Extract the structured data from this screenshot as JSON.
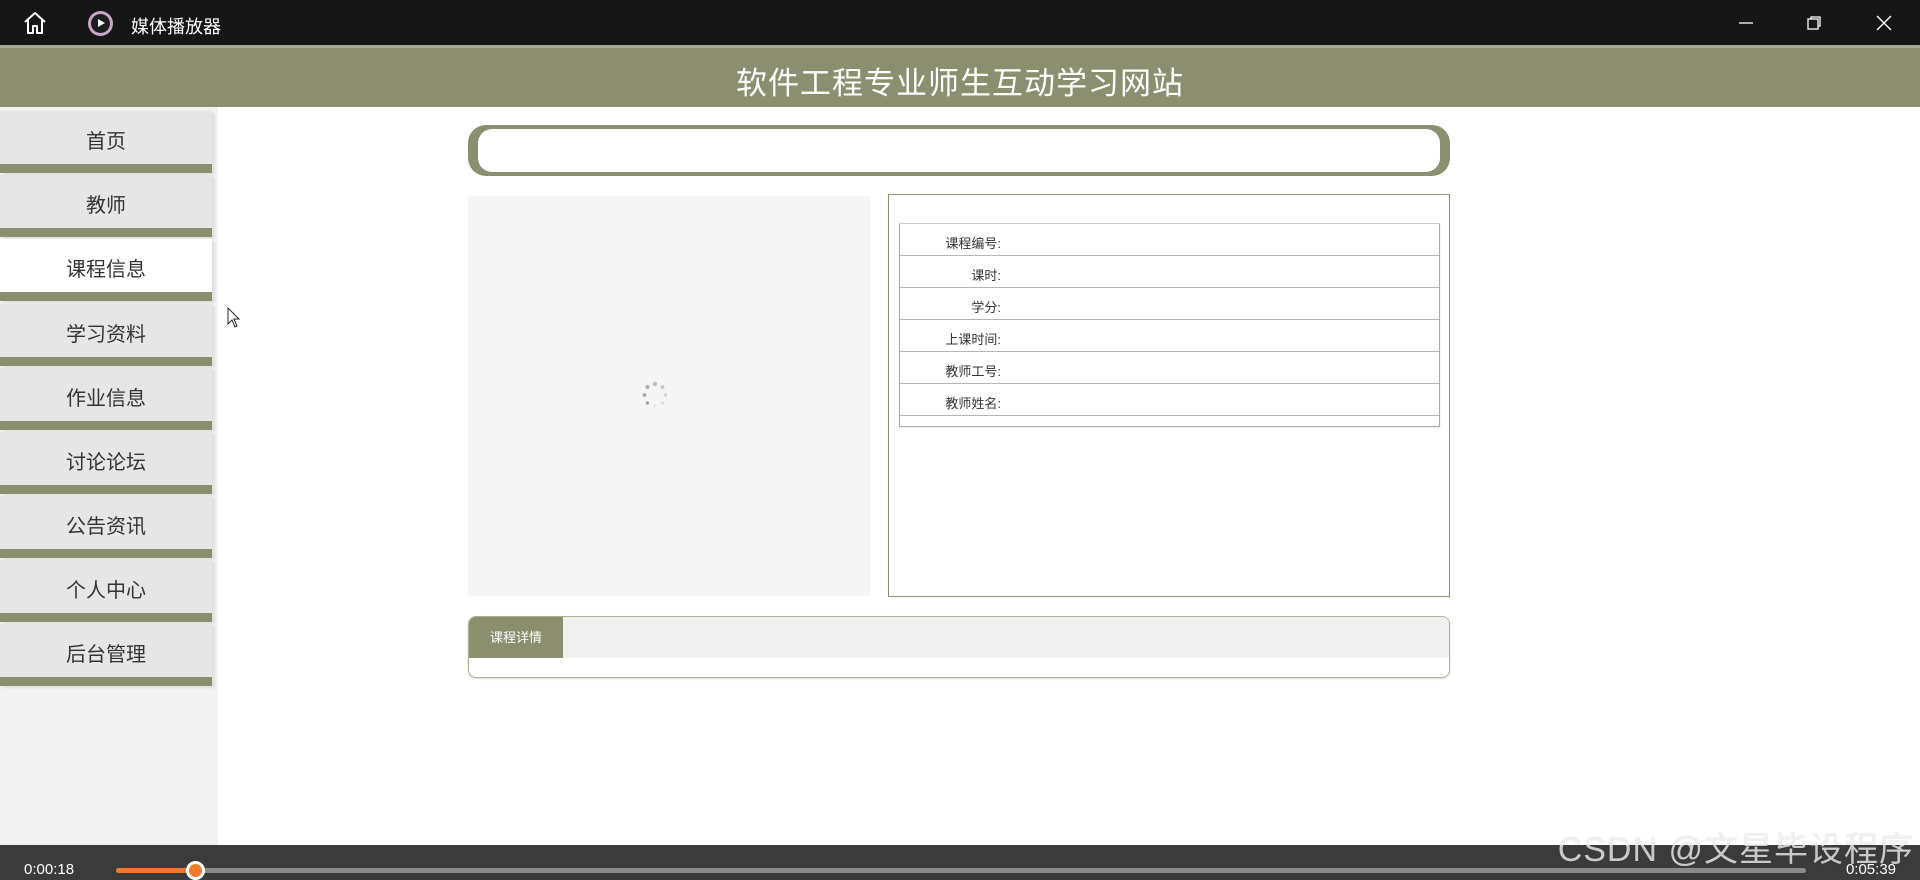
{
  "titlebar": {
    "app_title": "媒体播放器",
    "icons": [
      "home-icon",
      "media-player-icon",
      "minimize-icon",
      "restore-icon",
      "close-icon"
    ]
  },
  "site": {
    "title": "软件工程专业师生互动学习网站"
  },
  "sidebar": {
    "items": [
      {
        "label": "首页",
        "active": false
      },
      {
        "label": "教师",
        "active": false
      },
      {
        "label": "课程信息",
        "active": true
      },
      {
        "label": "学习资料",
        "active": false
      },
      {
        "label": "作业信息",
        "active": false
      },
      {
        "label": "讨论论坛",
        "active": false
      },
      {
        "label": "公告资讯",
        "active": false
      },
      {
        "label": "个人中心",
        "active": false
      },
      {
        "label": "后台管理",
        "active": false
      }
    ]
  },
  "course_info": {
    "rows": [
      {
        "key": "课程编号:",
        "value": ""
      },
      {
        "key": "课时:",
        "value": ""
      },
      {
        "key": "学分:",
        "value": ""
      },
      {
        "key": "上课时间:",
        "value": ""
      },
      {
        "key": "教师工号:",
        "value": ""
      },
      {
        "key": "教师姓名:",
        "value": ""
      }
    ]
  },
  "details": {
    "tab_label": "课程详情"
  },
  "player": {
    "current_time": "0:00:18",
    "total_time": "0:05:39",
    "progress": 0.047
  },
  "watermark": "CSDN @文星毕设程序",
  "colors": {
    "accent": "#8b8f6f",
    "titlebar": "#161616",
    "progress": "#f07a2b"
  }
}
